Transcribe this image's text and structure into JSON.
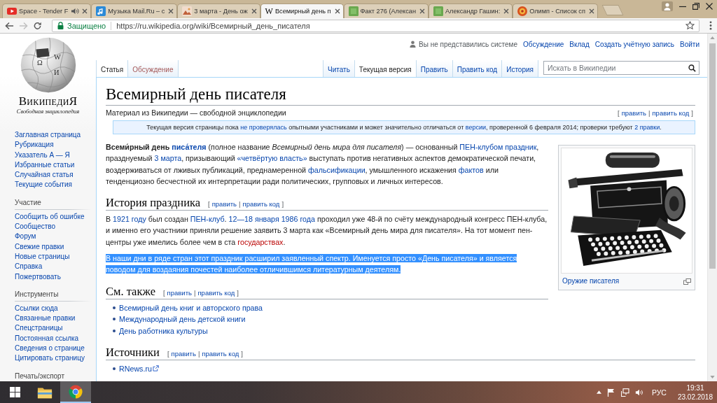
{
  "browser": {
    "tabs": [
      {
        "title": "Space - Tender F",
        "kind": "play",
        "audio": true,
        "selected": false
      },
      {
        "title": "Музыка Mail.Ru – с",
        "kind": "music",
        "audio": false,
        "selected": false
      },
      {
        "title": "3 марта - День ож",
        "kind": "photo",
        "audio": false,
        "selected": false
      },
      {
        "title": "Всемирный день п",
        "kind": "letter",
        "icon_text": "W",
        "audio": false,
        "selected": true
      },
      {
        "title": "Факт 276 (Алексан",
        "kind": "tile",
        "audio": false,
        "selected": false
      },
      {
        "title": "Александр Гашин:",
        "kind": "tile",
        "audio": false,
        "selected": false
      },
      {
        "title": "Олимп - Список сп",
        "kind": "emblem",
        "audio": false,
        "selected": false
      }
    ],
    "nav_buttons": [
      {
        "kind": "back",
        "disabled": false
      },
      {
        "kind": "forward",
        "disabled": true
      },
      {
        "kind": "reload",
        "disabled": false
      }
    ],
    "security_label": "Защищено",
    "url": "https://ru.wikipedia.org/wiki/Всемирный_день_писателя"
  },
  "wiki": {
    "logo": {
      "glyphs": [
        "Ω",
        "W",
        "И"
      ],
      "wordmark": "ВикипедиЯ",
      "tagline": "Свободная энциклопедия"
    },
    "sidebar": {
      "navigation": [
        "Заглавная страница",
        "Рубрикация",
        "Указатель А — Я",
        "Избранные статьи",
        "Случайная статья",
        "Текущие события"
      ],
      "portals": [
        {
          "heading": "Участие",
          "items": [
            "Сообщить об ошибке",
            "Сообщество",
            "Форум",
            "Свежие правки",
            "Новые страницы",
            "Справка",
            "Пожертвовать"
          ]
        },
        {
          "heading": "Инструменты",
          "items": [
            "Ссылки сюда",
            "Связанные правки",
            "Спецстраницы",
            "Постоянная ссылка",
            "Сведения о странице",
            "Цитировать страницу"
          ]
        },
        {
          "heading": "Печать/экспорт"
        }
      ]
    },
    "personal": {
      "status": "Вы не представились системе",
      "links": [
        "Обсуждение",
        "Вклад",
        "Создать учётную запись",
        "Войти"
      ]
    },
    "namespace_tabs": [
      {
        "label": "Статья",
        "selected": true,
        "missing": false
      },
      {
        "label": "Обсуждение",
        "selected": false,
        "missing": true
      }
    ],
    "view_tabs": [
      {
        "label": "Читать",
        "selected": false
      },
      {
        "label": "Текущая версия",
        "selected": true
      },
      {
        "label": "Править",
        "selected": false
      },
      {
        "label": "Править код",
        "selected": false
      },
      {
        "label": "История",
        "selected": false
      }
    ],
    "search": {
      "placeholder": "Искать в Википедии"
    },
    "article": {
      "title": "Всемирный день писателя",
      "tagline": "Материал из Википедии — свободной энциклопедии",
      "edit": {
        "brackets": [
          "[",
          "]"
        ],
        "separator": "|",
        "links": [
          "править",
          "править код"
        ]
      },
      "notice": [
        {
          "kind": "text",
          "text": "Текущая версия страницы пока "
        },
        {
          "kind": "link",
          "text": "не проверялась"
        },
        {
          "kind": "text",
          "text": " опытными участниками и может значительно отличаться от "
        },
        {
          "kind": "link",
          "text": "версии"
        },
        {
          "kind": "text",
          "text": ", проверенной 6 февраля 2014; проверки требуют "
        },
        {
          "kind": "link",
          "text": "2 правки"
        },
        {
          "kind": "text",
          "text": "."
        }
      ],
      "figure": {
        "caption": "Оружие писателя"
      },
      "content": [
        {
          "kind": "paragraph",
          "selected": false,
          "segments": [
            {
              "kind": "text",
              "text": "**Всеми́рный день** "
            },
            {
              "kind": "link",
              "text": "**писа́теля**"
            },
            {
              "kind": "text",
              "text": " (полное название *Всемирный день мира для писателя*) — основанный "
            },
            {
              "kind": "link",
              "text": "ПЕН-клубом праздник"
            },
            {
              "kind": "text",
              "text": ", празднуемый "
            },
            {
              "kind": "link",
              "text": "3 марта"
            },
            {
              "kind": "text",
              "text": ", призывающий "
            },
            {
              "kind": "link",
              "text": "«четвёртую власть»"
            },
            {
              "kind": "text",
              "text": " выступать против негативных аспектов демократической печати, воздерживаться от лживых публикаций, преднамеренной "
            },
            {
              "kind": "link",
              "text": "фальсификации"
            },
            {
              "kind": "text",
              "text": ", умышленного искажения "
            },
            {
              "kind": "link",
              "text": "фактов"
            },
            {
              "kind": "text",
              "text": " или тенденциозно бесчестной их интерпретации ради политических, групповых и личных интересов."
            }
          ]
        },
        {
          "kind": "heading",
          "title": "История праздника",
          "edit": {
            "brackets": [
              "[",
              "]"
            ],
            "separator": "|",
            "links": [
              "править",
              "править код"
            ]
          }
        },
        {
          "kind": "paragraph",
          "selected": false,
          "segments": [
            {
              "kind": "text",
              "text": "В "
            },
            {
              "kind": "link",
              "text": "1921 году"
            },
            {
              "kind": "text",
              "text": " был создан "
            },
            {
              "kind": "link",
              "text": "ПЕН-клуб"
            },
            {
              "kind": "text",
              "text": ". "
            },
            {
              "kind": "link",
              "text": "12—18 января 1986 года"
            },
            {
              "kind": "text",
              "text": " проходил уже 48-й по счёту международный конгресс ПЕН-клуба, и именно его участники приняли решение заявить 3 марта как «Всемирный день мира для писателя». На тот момент пен-центры уже имелись более чем в ста "
            },
            {
              "kind": "redlink",
              "text": "государствах"
            },
            {
              "kind": "text",
              "text": "."
            }
          ]
        },
        {
          "kind": "paragraph",
          "selected": true,
          "segments": [
            {
              "kind": "text",
              "text": "В наши дни в ряде стран этот праздник расширил заявленный спектр. Именуется просто «День писателя» и является поводом для воздаяния почестей наиболее отличившимся литературным деятелям."
            }
          ]
        },
        {
          "kind": "heading",
          "title": "См. также",
          "edit": {
            "brackets": [
              "[",
              "]"
            ],
            "separator": "|",
            "links": [
              "править",
              "править код"
            ]
          }
        },
        {
          "kind": "list",
          "items": [
            {
              "segments": [
                {
                  "kind": "link",
                  "text": "Всемирный день книг и авторского права"
                }
              ]
            },
            {
              "segments": [
                {
                  "kind": "link",
                  "text": "Международный день детской книги"
                }
              ]
            },
            {
              "segments": [
                {
                  "kind": "link",
                  "text": "День работника культуры"
                }
              ]
            }
          ]
        },
        {
          "kind": "heading",
          "title": "Источники",
          "edit": {
            "brackets": [
              "[",
              "]"
            ],
            "separator": "|",
            "links": [
              "править",
              "править код"
            ]
          }
        },
        {
          "kind": "list",
          "items": [
            {
              "segments": [
                {
                  "kind": "extlink",
                  "text": "RNews.ru"
                }
              ]
            }
          ]
        }
      ]
    }
  },
  "taskbar": {
    "apps": [
      {
        "kind": "folder",
        "active": false
      },
      {
        "kind": "browser",
        "active": true
      }
    ],
    "language": "РУС",
    "time": "19:31",
    "date": "23.02.2018"
  }
}
